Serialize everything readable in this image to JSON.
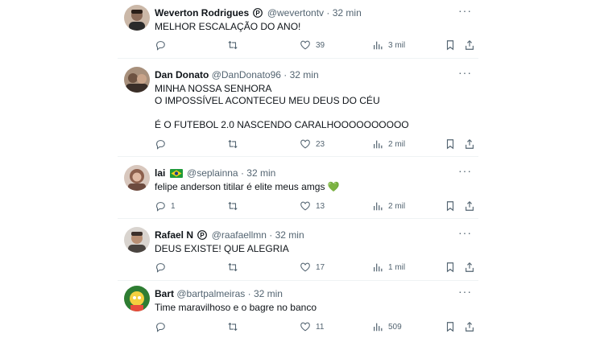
{
  "tweets": [
    {
      "name": "Weverton Rodrigues",
      "handle": "@wevertontv",
      "time": "32 min",
      "text": "MELHOR ESCALAÇÃO DO ANO!",
      "replies": "",
      "retweets": "",
      "likes": "39",
      "views": "3 mil",
      "badge": "verified-p",
      "avatar_color": "#6b4a3a"
    },
    {
      "name": "Dan Donato",
      "handle": "@DanDonato96",
      "time": "32 min",
      "text": "MINHA NOSSA SENHORA\nO IMPOSSÍVEL ACONTECEU MEU DEUS DO CÉU\n\nÉ O FUTEBOL 2.0 NASCENDO CARALHOOOOOOOOOO",
      "replies": "",
      "retweets": "",
      "likes": "23",
      "views": "2 mil",
      "badge": "",
      "avatar_color": "#3a2e28"
    },
    {
      "name": "lai",
      "handle": "@seplainna",
      "time": "32 min",
      "text": "felipe anderson titilar é elite meus amgs 💚",
      "replies": "1",
      "retweets": "",
      "likes": "13",
      "views": "2 mil",
      "badge": "brazil-flag",
      "avatar_color": "#b98a76"
    },
    {
      "name": "Rafael N",
      "handle": "@raafaellmn",
      "time": "32 min",
      "text": "DEUS EXISTE! QUE ALEGRIA",
      "replies": "",
      "retweets": "",
      "likes": "17",
      "views": "1 mil",
      "badge": "verified-p",
      "avatar_color": "#4a4440"
    },
    {
      "name": "Bart",
      "handle": "@bartpalmeiras",
      "time": "32 min",
      "text": "Time maravilhoso e o bagre no banco",
      "replies": "",
      "retweets": "",
      "likes": "11",
      "views": "509",
      "badge": "",
      "avatar_color": "#2e7d32"
    }
  ],
  "more_label": "···"
}
